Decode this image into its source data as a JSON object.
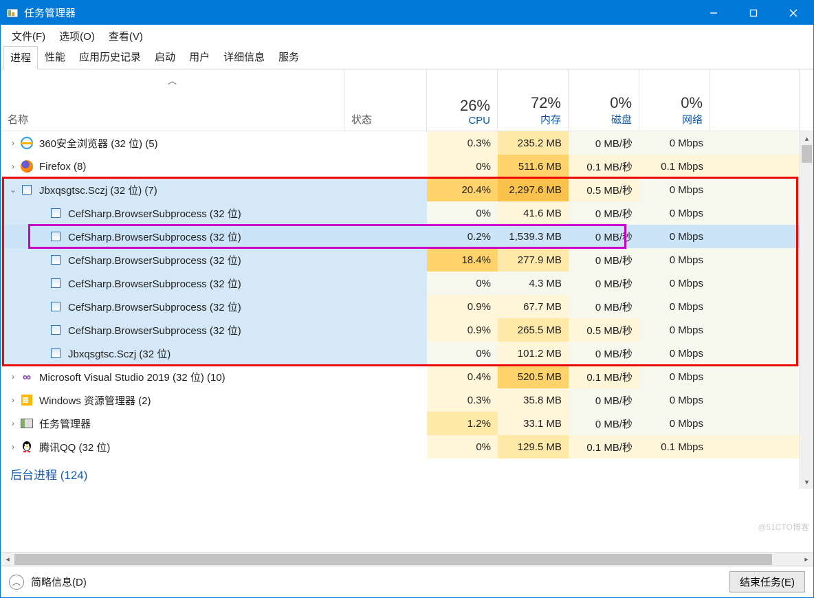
{
  "title": "任务管理器",
  "menu": {
    "file": "文件(F)",
    "options": "选项(O)",
    "view": "查看(V)"
  },
  "tabs": [
    "进程",
    "性能",
    "应用历史记录",
    "启动",
    "用户",
    "详细信息",
    "服务"
  ],
  "columns": {
    "name": "名称",
    "status": "状态",
    "cpu": {
      "pct": "26%",
      "label": "CPU"
    },
    "mem": {
      "pct": "72%",
      "label": "内存"
    },
    "disk": {
      "pct": "0%",
      "label": "磁盘"
    },
    "net": {
      "pct": "0%",
      "label": "网络"
    }
  },
  "rows": [
    {
      "type": "proc",
      "icon": "ie",
      "name": "360安全浏览器 (32 位) (5)",
      "cpu": "0.3%",
      "mem": "235.2 MB",
      "disk": "0 MB/秒",
      "net": "0 Mbps",
      "expandable": true,
      "heat": {
        "cpu": "h-cpu1",
        "mem": "h-mem2",
        "disk": "h-idle",
        "net": "h-idle"
      }
    },
    {
      "type": "proc",
      "icon": "ff",
      "name": "Firefox (8)",
      "cpu": "0%",
      "mem": "511.6 MB",
      "disk": "0.1 MB/秒",
      "net": "0.1 Mbps",
      "expandable": true,
      "heat": {
        "cpu": "h-cpu1",
        "mem": "h-mem3",
        "disk": "h-disk1",
        "net": "h-net1"
      }
    },
    {
      "type": "proc",
      "icon": "gen",
      "name": "Jbxqsgtsc.Sczj (32 位) (7)",
      "cpu": "20.4%",
      "mem": "2,297.6 MB",
      "disk": "0.5 MB/秒",
      "net": "0 Mbps",
      "expandable": true,
      "expanded": true,
      "group": "sel",
      "heat": {
        "cpu": "h-cpu3",
        "mem": "h-mem-high",
        "disk": "h-disk1",
        "net": "h-idle"
      }
    },
    {
      "type": "child",
      "icon": "gen",
      "name": "CefSharp.BrowserSubprocess (32 位)",
      "cpu": "0%",
      "mem": "41.6 MB",
      "disk": "0 MB/秒",
      "net": "0 Mbps",
      "group": "sel",
      "heat": {
        "cpu": "h-idle",
        "mem": "h-mem1",
        "disk": "h-idle",
        "net": "h-idle"
      }
    },
    {
      "type": "child",
      "icon": "gen",
      "name": "CefSharp.BrowserSubprocess (32 位)",
      "cpu": "0.2%",
      "mem": "1,539.3 MB",
      "disk": "0 MB/秒",
      "net": "0 Mbps",
      "group": "sel",
      "selected": true,
      "heat": {
        "cpu": "h-cpu1",
        "mem": "h-mem-high",
        "disk": "h-idle",
        "net": "h-idle"
      }
    },
    {
      "type": "child",
      "icon": "gen",
      "name": "CefSharp.BrowserSubprocess (32 位)",
      "cpu": "18.4%",
      "mem": "277.9 MB",
      "disk": "0 MB/秒",
      "net": "0 Mbps",
      "group": "sel",
      "heat": {
        "cpu": "h-cpu3",
        "mem": "h-mem2",
        "disk": "h-idle",
        "net": "h-idle"
      }
    },
    {
      "type": "child",
      "icon": "gen",
      "name": "CefSharp.BrowserSubprocess (32 位)",
      "cpu": "0%",
      "mem": "4.3 MB",
      "disk": "0 MB/秒",
      "net": "0 Mbps",
      "group": "sel",
      "heat": {
        "cpu": "h-idle",
        "mem": "h-idle",
        "disk": "h-idle",
        "net": "h-idle"
      }
    },
    {
      "type": "child",
      "icon": "gen",
      "name": "CefSharp.BrowserSubprocess (32 位)",
      "cpu": "0.9%",
      "mem": "67.7 MB",
      "disk": "0 MB/秒",
      "net": "0 Mbps",
      "group": "sel",
      "heat": {
        "cpu": "h-cpu1",
        "mem": "h-mem1",
        "disk": "h-idle",
        "net": "h-idle"
      }
    },
    {
      "type": "child",
      "icon": "gen",
      "name": "CefSharp.BrowserSubprocess (32 位)",
      "cpu": "0.9%",
      "mem": "265.5 MB",
      "disk": "0.5 MB/秒",
      "net": "0 Mbps",
      "group": "sel",
      "heat": {
        "cpu": "h-cpu1",
        "mem": "h-mem2",
        "disk": "h-disk1",
        "net": "h-idle"
      }
    },
    {
      "type": "child",
      "icon": "gen",
      "name": "Jbxqsgtsc.Sczj (32 位)",
      "cpu": "0%",
      "mem": "101.2 MB",
      "disk": "0 MB/秒",
      "net": "0 Mbps",
      "group": "sel",
      "heat": {
        "cpu": "h-idle",
        "mem": "h-mem1",
        "disk": "h-idle",
        "net": "h-idle"
      }
    },
    {
      "type": "proc",
      "icon": "vs",
      "name": "Microsoft Visual Studio 2019 (32 位) (10)",
      "cpu": "0.4%",
      "mem": "520.5 MB",
      "disk": "0.1 MB/秒",
      "net": "0 Mbps",
      "expandable": true,
      "heat": {
        "cpu": "h-cpu1",
        "mem": "h-mem3",
        "disk": "h-disk1",
        "net": "h-idle"
      }
    },
    {
      "type": "proc",
      "icon": "win",
      "name": "Windows 资源管理器 (2)",
      "cpu": "0.3%",
      "mem": "35.8 MB",
      "disk": "0 MB/秒",
      "net": "0 Mbps",
      "expandable": true,
      "heat": {
        "cpu": "h-cpu1",
        "mem": "h-mem1",
        "disk": "h-idle",
        "net": "h-idle"
      }
    },
    {
      "type": "proc",
      "icon": "tm",
      "name": "任务管理器",
      "cpu": "1.2%",
      "mem": "33.1 MB",
      "disk": "0 MB/秒",
      "net": "0 Mbps",
      "expandable": true,
      "heat": {
        "cpu": "h-cpu2",
        "mem": "h-mem1",
        "disk": "h-idle",
        "net": "h-idle"
      }
    },
    {
      "type": "proc",
      "icon": "qq",
      "name": "腾讯QQ (32 位)",
      "cpu": "0%",
      "mem": "129.5 MB",
      "disk": "0.1 MB/秒",
      "net": "0.1 Mbps",
      "expandable": true,
      "heat": {
        "cpu": "h-cpu1",
        "mem": "h-mem2",
        "disk": "h-disk1",
        "net": "h-net1"
      }
    },
    {
      "type": "category",
      "name": "后台进程 (124)"
    }
  ],
  "footer": {
    "fewer": "简略信息(D)",
    "end": "结束任务(E)"
  },
  "watermark": "@51CTO博客"
}
